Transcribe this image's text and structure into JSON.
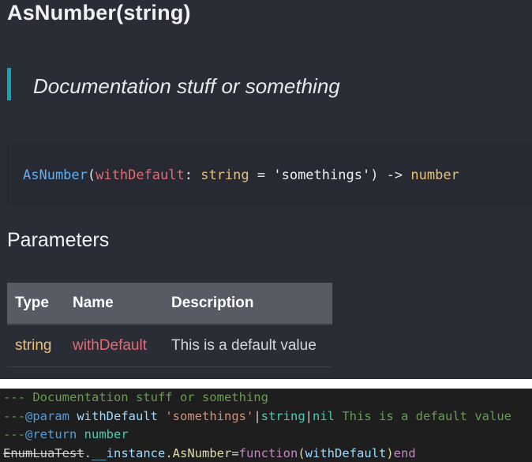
{
  "doc": {
    "title": "AsNumber(string)",
    "quote": "Documentation stuff or something",
    "signature": {
      "fn": "AsNumber",
      "open": "(",
      "param": "withDefault",
      "colon": ": ",
      "type": "string",
      "eq": " = ",
      "default": "'somethings'",
      "close_arrow": ") -> ",
      "return_type": "number"
    },
    "parameters_heading": "Parameters",
    "table": {
      "headers": [
        "Type",
        "Name",
        "Description"
      ],
      "rows": [
        {
          "type": "string",
          "name": "withDefault",
          "description": "This is a default value"
        }
      ]
    }
  },
  "code": {
    "line1": "--- Documentation stuff or something",
    "line2": {
      "prefix": "---",
      "tag": "@param",
      "sp1": " ",
      "name": "withDefault",
      "sp2": " ",
      "default": "'somethings'",
      "pipe1": "|",
      "type1": "string",
      "pipe2": "|",
      "type2": "nil",
      "desc": " This is a default value"
    },
    "line3": {
      "prefix": "---",
      "tag": "@return",
      "sp": " ",
      "type": "number"
    },
    "line4": {
      "obj": "EnumLuaTest",
      "dot1": ".",
      "inst": "__instance",
      "dot2": ".",
      "fn": "AsNumber",
      "eq": "=",
      "kw": "function",
      "open": "(",
      "param": "withDefault",
      "close": ")",
      "end": "end"
    }
  },
  "colors": {
    "doc_bg": "#2b2d36",
    "accent": "#17a2b8",
    "function": "#61afef",
    "param": "#e06c75",
    "type": "#e5c07b",
    "editor_bg": "#1e1e1e",
    "comment": "#6a9955"
  }
}
